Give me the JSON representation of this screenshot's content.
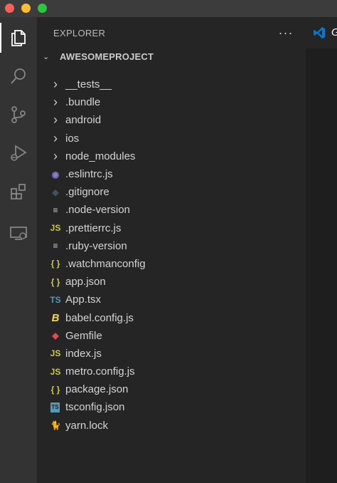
{
  "sidebar": {
    "title": "EXPLORER",
    "more_label": "···",
    "project": {
      "chevron": "⌄",
      "name": "AWESOMEPROJECT"
    }
  },
  "editor": {
    "tab_label": "G"
  },
  "activity_bar": [
    "explorer-icon",
    "search-icon",
    "source-control-icon",
    "run-debug-icon",
    "extensions-icon",
    "remote-explorer-icon"
  ],
  "colors": {
    "yellow_js": "#cbcb41",
    "json_braces": "#cbcb41",
    "ts_blue": "#519aba",
    "ruby_red": "#e34c4c",
    "eslint_purple": "#8f7ad6",
    "babel_yellow": "#f5da55",
    "yarn_blue": "#4c9ce0"
  },
  "files": [
    {
      "label": "__tests__",
      "icon": "›",
      "icon_name": "chevron-right-icon",
      "kind": "folder"
    },
    {
      "label": ".bundle",
      "icon": "›",
      "icon_name": "chevron-right-icon",
      "kind": "folder"
    },
    {
      "label": "android",
      "icon": "›",
      "icon_name": "chevron-right-icon",
      "kind": "folder"
    },
    {
      "label": "ios",
      "icon": "›",
      "icon_name": "chevron-right-icon",
      "kind": "folder"
    },
    {
      "label": "node_modules",
      "icon": "›",
      "icon_name": "chevron-right-icon",
      "kind": "folder"
    },
    {
      "label": ".eslintrc.js",
      "icon": "◉",
      "icon_name": "eslint-icon",
      "kind": "file"
    },
    {
      "label": ".gitignore",
      "icon": "◆",
      "icon_name": "git-icon",
      "kind": "file"
    },
    {
      "label": ".node-version",
      "icon": "≡",
      "icon_name": "text-file-icon",
      "kind": "file"
    },
    {
      "label": ".prettierrc.js",
      "icon": "JS",
      "icon_name": "javascript-icon",
      "kind": "file"
    },
    {
      "label": ".ruby-version",
      "icon": "≡",
      "icon_name": "text-file-icon",
      "kind": "file"
    },
    {
      "label": ".watchmanconfig",
      "icon": "{ }",
      "icon_name": "json-icon",
      "kind": "file"
    },
    {
      "label": "app.json",
      "icon": "{ }",
      "icon_name": "json-icon",
      "kind": "file"
    },
    {
      "label": "App.tsx",
      "icon": "TS",
      "icon_name": "typescript-icon",
      "kind": "file"
    },
    {
      "label": "babel.config.js",
      "icon": "B",
      "icon_name": "babel-icon",
      "kind": "file"
    },
    {
      "label": "Gemfile",
      "icon": "◆",
      "icon_name": "ruby-icon",
      "kind": "file"
    },
    {
      "label": "index.js",
      "icon": "JS",
      "icon_name": "javascript-icon",
      "kind": "file"
    },
    {
      "label": "metro.config.js",
      "icon": "JS",
      "icon_name": "javascript-icon",
      "kind": "file"
    },
    {
      "label": "package.json",
      "icon": "{ }",
      "icon_name": "json-icon",
      "kind": "file"
    },
    {
      "label": "tsconfig.json",
      "icon": "TS",
      "icon_name": "tsconfig-icon",
      "kind": "file"
    },
    {
      "label": "yarn.lock",
      "icon": "🐈",
      "icon_name": "yarn-icon",
      "kind": "file"
    }
  ]
}
